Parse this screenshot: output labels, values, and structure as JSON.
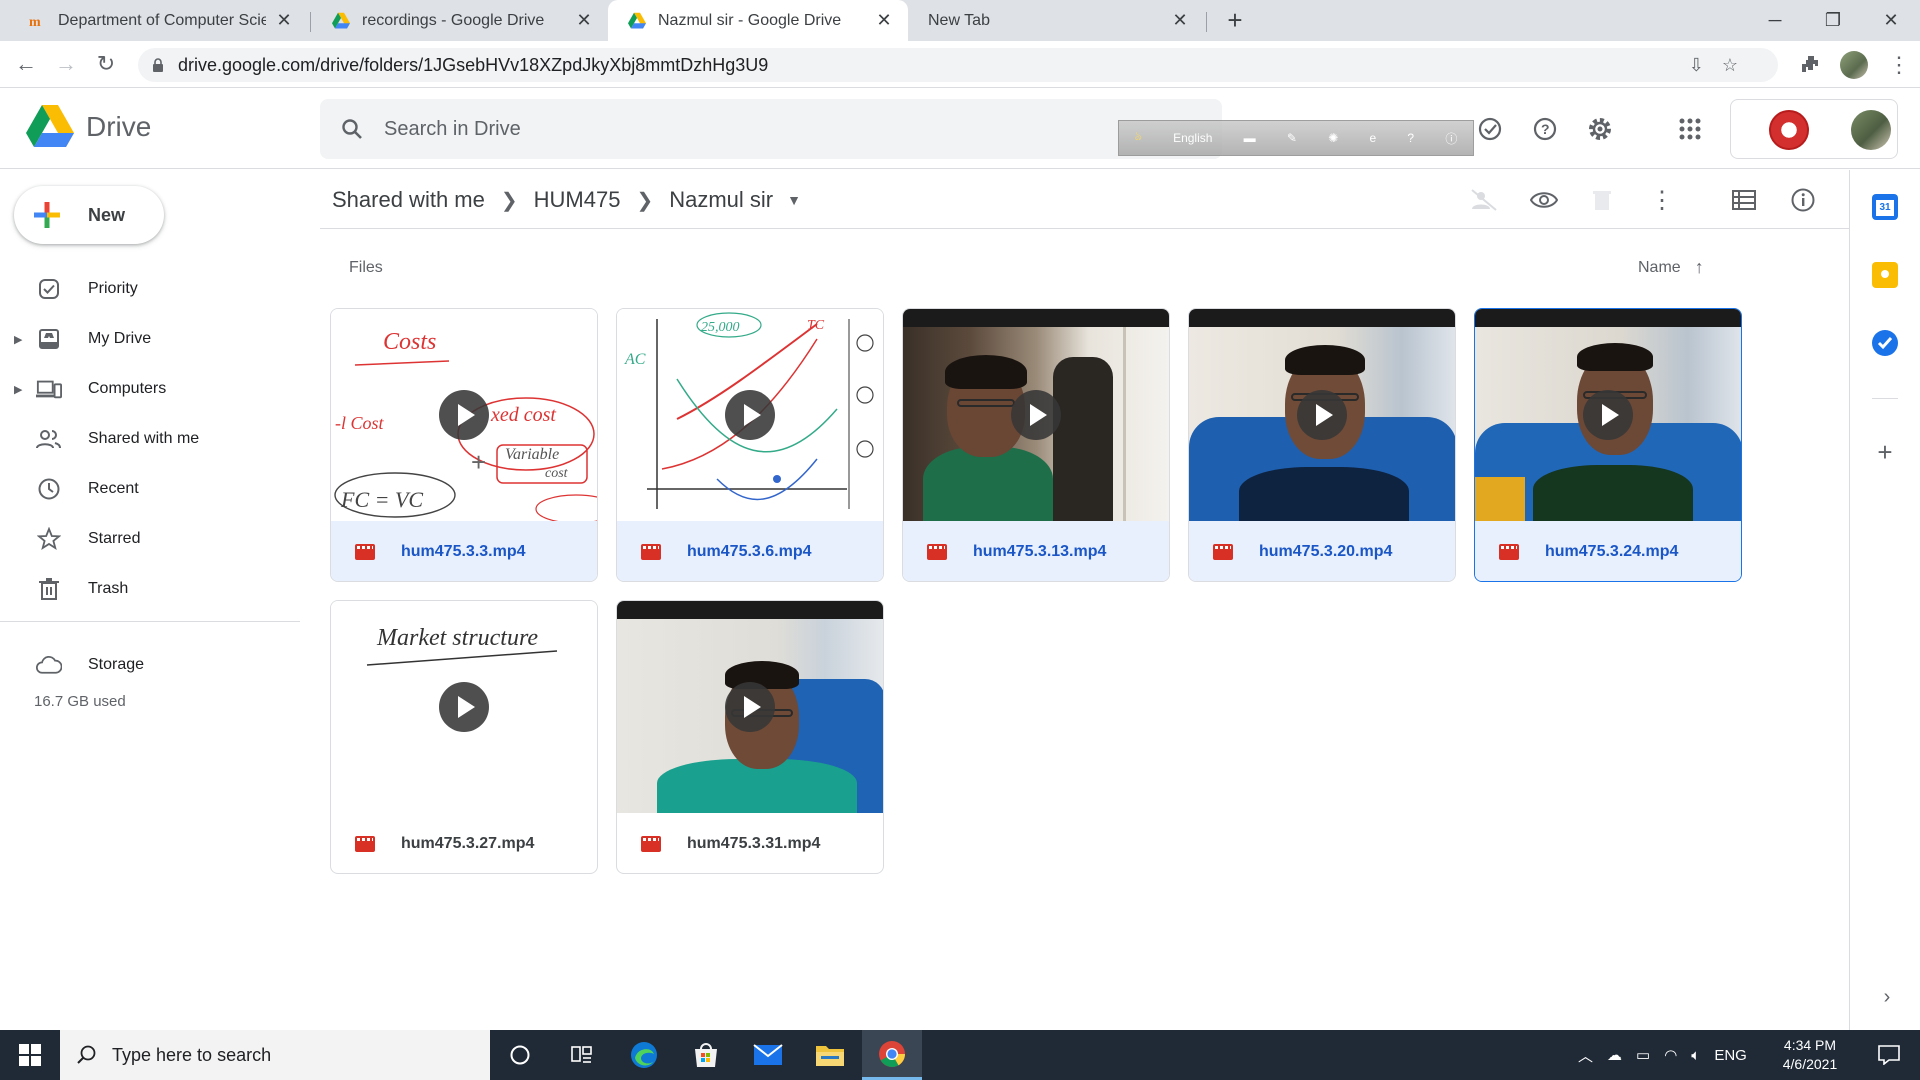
{
  "browser": {
    "tabs": [
      {
        "title": "Department of Computer Science",
        "icon": "site-icon",
        "active": false
      },
      {
        "title": "recordings - Google Drive",
        "icon": "drive-icon",
        "active": false
      },
      {
        "title": "Nazmul sir - Google Drive",
        "icon": "drive-icon",
        "active": true
      },
      {
        "title": "New Tab",
        "icon": "",
        "active": false
      }
    ],
    "new_tab": "+",
    "url": "drive.google.com/drive/folders/1JGsebHVv18XZpdJkyXbj8mmtDzhHg3U9"
  },
  "drive": {
    "app_name": "Drive",
    "search_placeholder": "Search in Drive",
    "language_bar": "English",
    "new_button": "New",
    "nav": [
      {
        "label": "Priority",
        "icon": "priority-icon"
      },
      {
        "label": "My Drive",
        "icon": "my-drive-icon"
      },
      {
        "label": "Computers",
        "icon": "computers-icon"
      },
      {
        "label": "Shared with me",
        "icon": "shared-icon"
      },
      {
        "label": "Recent",
        "icon": "recent-icon"
      },
      {
        "label": "Starred",
        "icon": "starred-icon"
      },
      {
        "label": "Trash",
        "icon": "trash-icon"
      }
    ],
    "storage_label": "Storage",
    "storage_used": "16.7 GB used",
    "breadcrumbs": [
      "Shared with me",
      "HUM475",
      "Nazmul sir"
    ],
    "section_label": "Files",
    "sort_label": "Name",
    "files": [
      {
        "name": "hum475.3.3.mp4",
        "thumb": "whiteboard",
        "thumb_text": [
          "Costs",
          "xed cost",
          "Variable",
          "cost",
          "FC = VC"
        ]
      },
      {
        "name": "hum475.3.6.mp4",
        "thumb": "graph",
        "thumb_text": [
          "AC",
          "TC",
          "25,000"
        ]
      },
      {
        "name": "hum475.3.13.mp4",
        "thumb": "video"
      },
      {
        "name": "hum475.3.20.mp4",
        "thumb": "video"
      },
      {
        "name": "hum475.3.24.mp4",
        "thumb": "video"
      },
      {
        "name": "hum475.3.27.mp4",
        "thumb": "whiteboard",
        "thumb_text": [
          "Market structure"
        ]
      },
      {
        "name": "hum475.3.31.mp4",
        "thumb": "video"
      }
    ],
    "selected_file": "hum475.3.24.mp4"
  },
  "taskbar": {
    "search_placeholder": "Type here to search",
    "language": "ENG",
    "time": "4:34 PM",
    "date": "4/6/2021"
  },
  "colors": {
    "accent": "#1a73e8",
    "file_highlight": "#e8f0fe",
    "video_icon": "#d93025"
  }
}
